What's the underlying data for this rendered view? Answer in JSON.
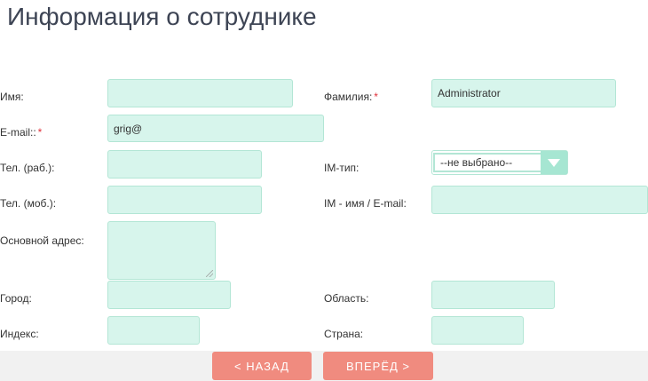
{
  "title": "Информация о сотруднике",
  "form": {
    "first_name": {
      "label": "Имя:",
      "value": ""
    },
    "last_name": {
      "label": "Фамилия:",
      "required_mark": "*",
      "value": "Administrator"
    },
    "email": {
      "label": "E-mail::",
      "required_mark": "*",
      "value": "grig@"
    },
    "work_phone": {
      "label": "Тел. (раб.):",
      "value": ""
    },
    "im_type": {
      "label": "IM-тип:",
      "selected": "--не выбрано--"
    },
    "mobile_phone": {
      "label": "Тел. (моб.):",
      "value": ""
    },
    "im_name": {
      "label": "IM - имя / E-mail:",
      "value": ""
    },
    "address": {
      "label": "Основной адрес:",
      "value": ""
    },
    "city": {
      "label": "Город:",
      "value": ""
    },
    "region": {
      "label": "Область:",
      "value": ""
    },
    "zip": {
      "label": "Индекс:",
      "value": ""
    },
    "country": {
      "label": "Страна:",
      "value": ""
    }
  },
  "buttons": {
    "back": "< НАЗАД",
    "next": "ВПЕРЁД >"
  },
  "colors": {
    "field_bg": "#d7f5ec",
    "field_border": "#b3e6d5",
    "button_bg": "#f08b7f",
    "required": "#e0303a"
  }
}
